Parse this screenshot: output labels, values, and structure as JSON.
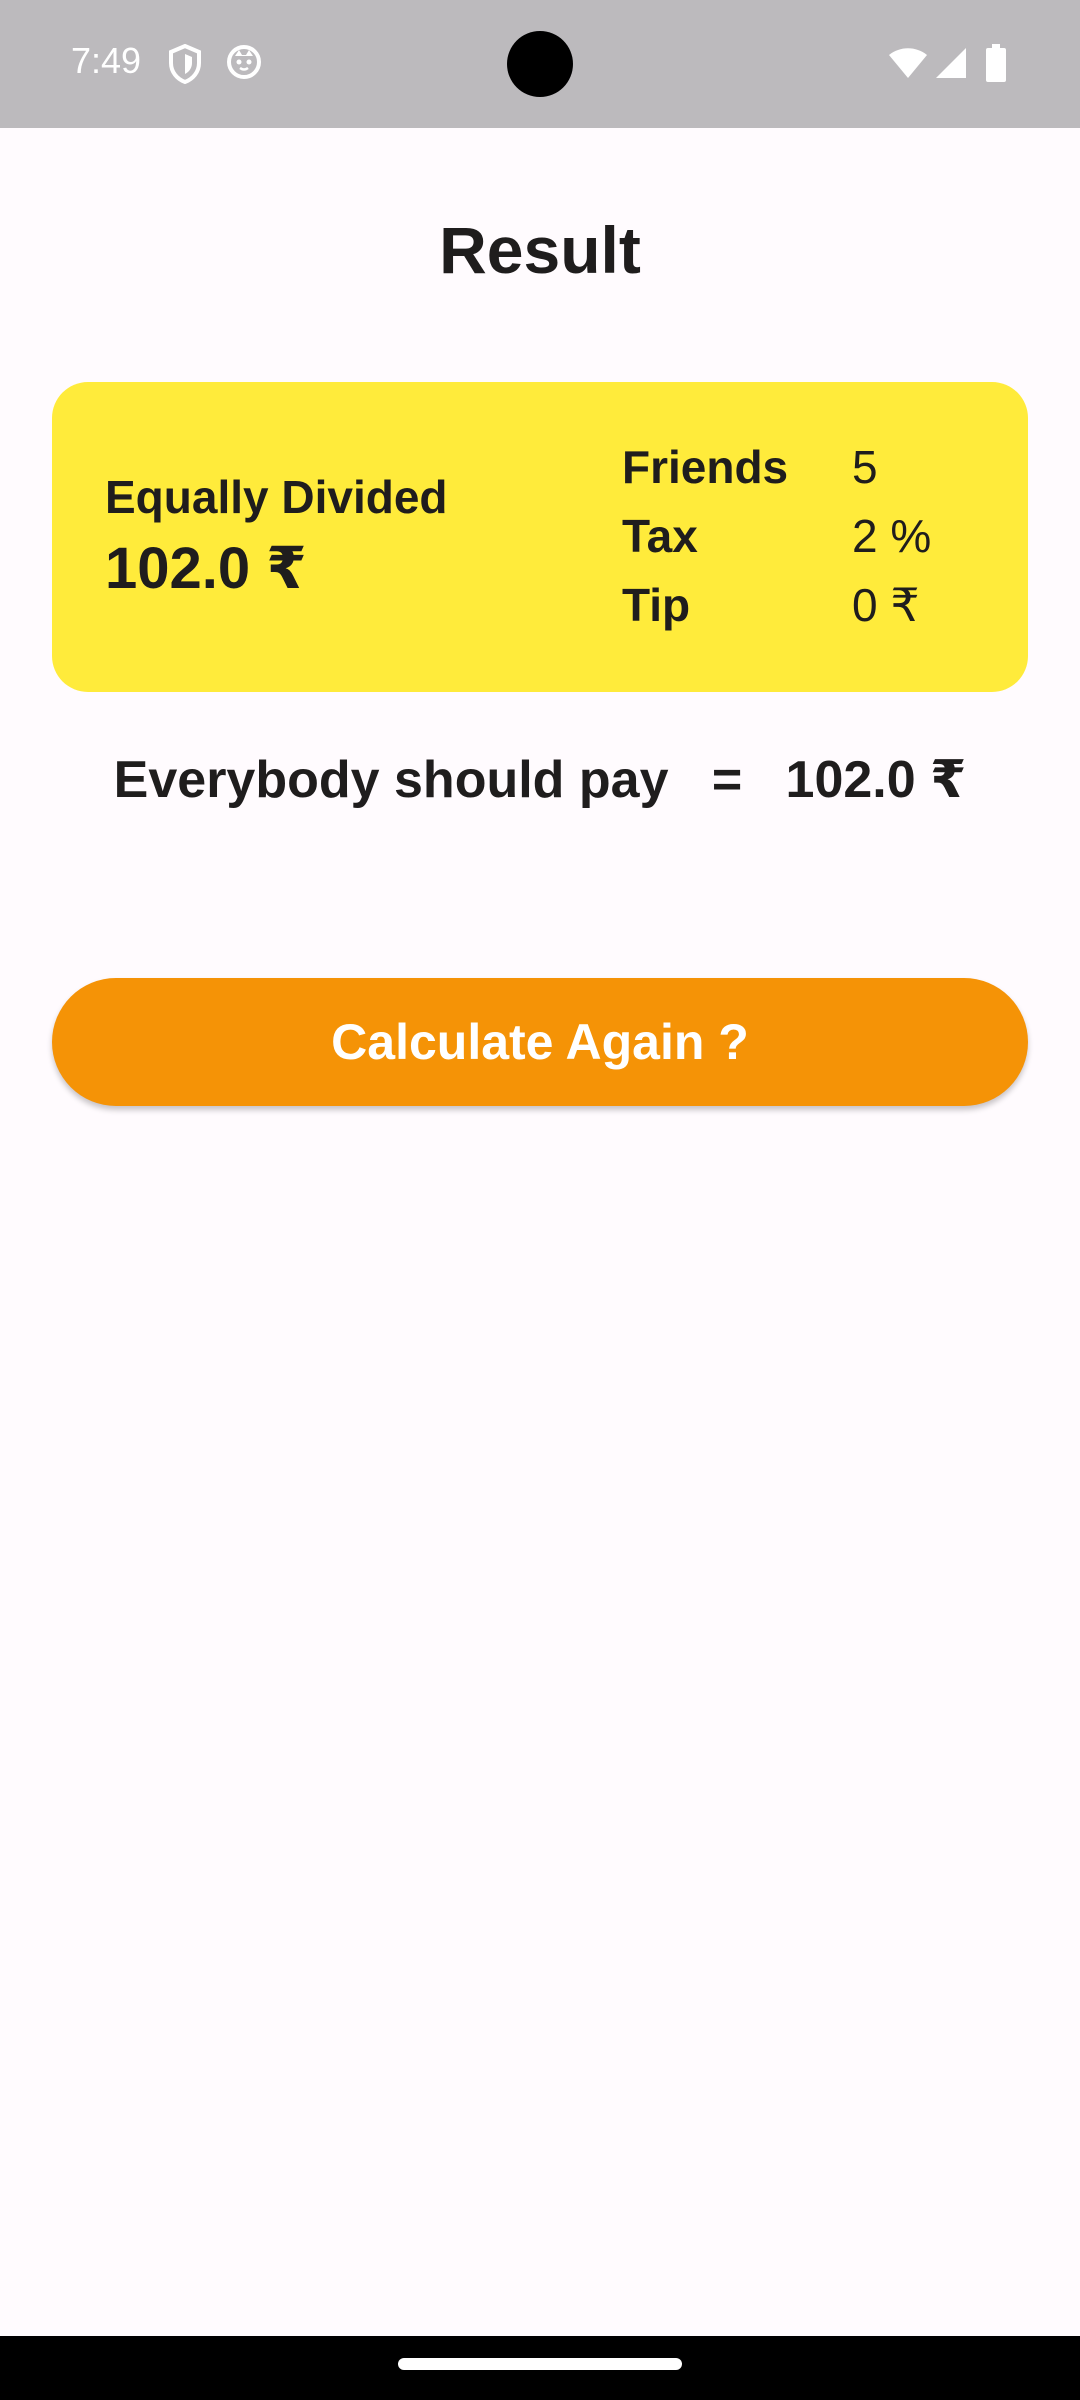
{
  "status_bar": {
    "time": "7:49",
    "icons": [
      "shield-icon",
      "cat-icon",
      "wifi-icon",
      "signal-icon",
      "battery-icon"
    ]
  },
  "title": "Result",
  "summary": {
    "equally_divided_label": "Equally Divided",
    "equally_divided_value": "102.0 ₹",
    "rows": [
      {
        "label": "Friends",
        "value": "5"
      },
      {
        "label": "Tax",
        "value": "2 %"
      },
      {
        "label": "Tip",
        "value": "0 ₹"
      }
    ]
  },
  "total": {
    "label": "Everybody should pay",
    "equals": "=",
    "value": "102.0 ₹"
  },
  "button": {
    "label": "Calculate Again ?"
  },
  "colors": {
    "status_bar": "#bcbabd",
    "background": "#fffbfe",
    "card": "#ffeb3b",
    "button": "#f59306",
    "text": "#1f1d1d"
  }
}
